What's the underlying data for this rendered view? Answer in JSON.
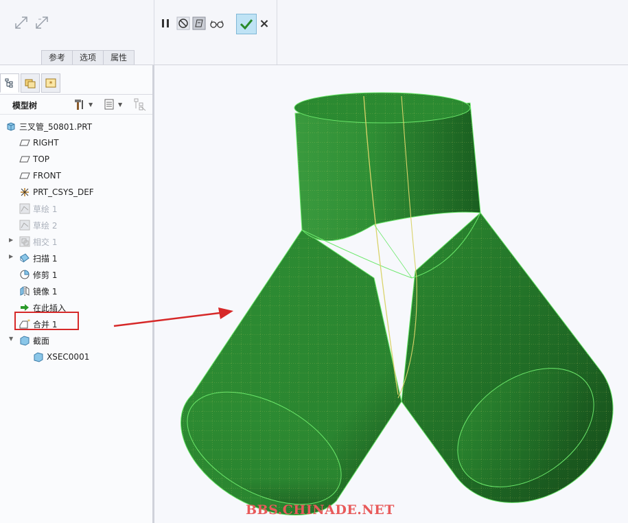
{
  "ribbon": {
    "tabs": [
      "参考",
      "选项",
      "属性"
    ],
    "tools_left": [
      "resize-arrow-icon",
      "resize-arrow-alt-icon"
    ],
    "tools_mid": [
      "pause-icon",
      "no-preview-icon",
      "preview-geometry-icon",
      "verify-glasses-icon"
    ],
    "ok_icon": "checkmark-icon",
    "cancel_label": "×"
  },
  "sidebar": {
    "tree_title": "模型树",
    "items": [
      {
        "label": "三叉管_50801.PRT",
        "icon": "part-icon",
        "dim": false
      },
      {
        "label": "RIGHT",
        "icon": "datum-plane-icon",
        "dim": false
      },
      {
        "label": "TOP",
        "icon": "datum-plane-icon",
        "dim": false
      },
      {
        "label": "FRONT",
        "icon": "datum-plane-icon",
        "dim": false
      },
      {
        "label": "PRT_CSYS_DEF",
        "icon": "csys-icon",
        "dim": false
      },
      {
        "label": "草绘 1",
        "icon": "sketch-icon",
        "dim": true
      },
      {
        "label": "草绘 2",
        "icon": "sketch-icon",
        "dim": true
      },
      {
        "label": "相交 1",
        "icon": "intersect-icon",
        "dim": true
      },
      {
        "label": "扫描 1",
        "icon": "sweep-icon",
        "dim": false
      },
      {
        "label": "修剪 1",
        "icon": "trim-icon",
        "dim": false
      },
      {
        "label": "镜像 1",
        "icon": "mirror-icon",
        "dim": false
      },
      {
        "label": "在此插入",
        "icon": "insert-here-arrow-icon",
        "dim": false
      },
      {
        "label": "合并 1",
        "icon": "merge-icon",
        "dim": false
      },
      {
        "label": "截面",
        "icon": "section-folder-icon",
        "dim": false
      },
      {
        "label": "XSEC0001",
        "icon": "section-icon",
        "dim": false
      }
    ]
  },
  "colors": {
    "highlight_box": "#d62828",
    "arrow": "#d62828",
    "model_green": "#2e8a35",
    "mesh_yellow": "#d9d36a"
  },
  "watermark": "BBS.CHINADE.NET"
}
